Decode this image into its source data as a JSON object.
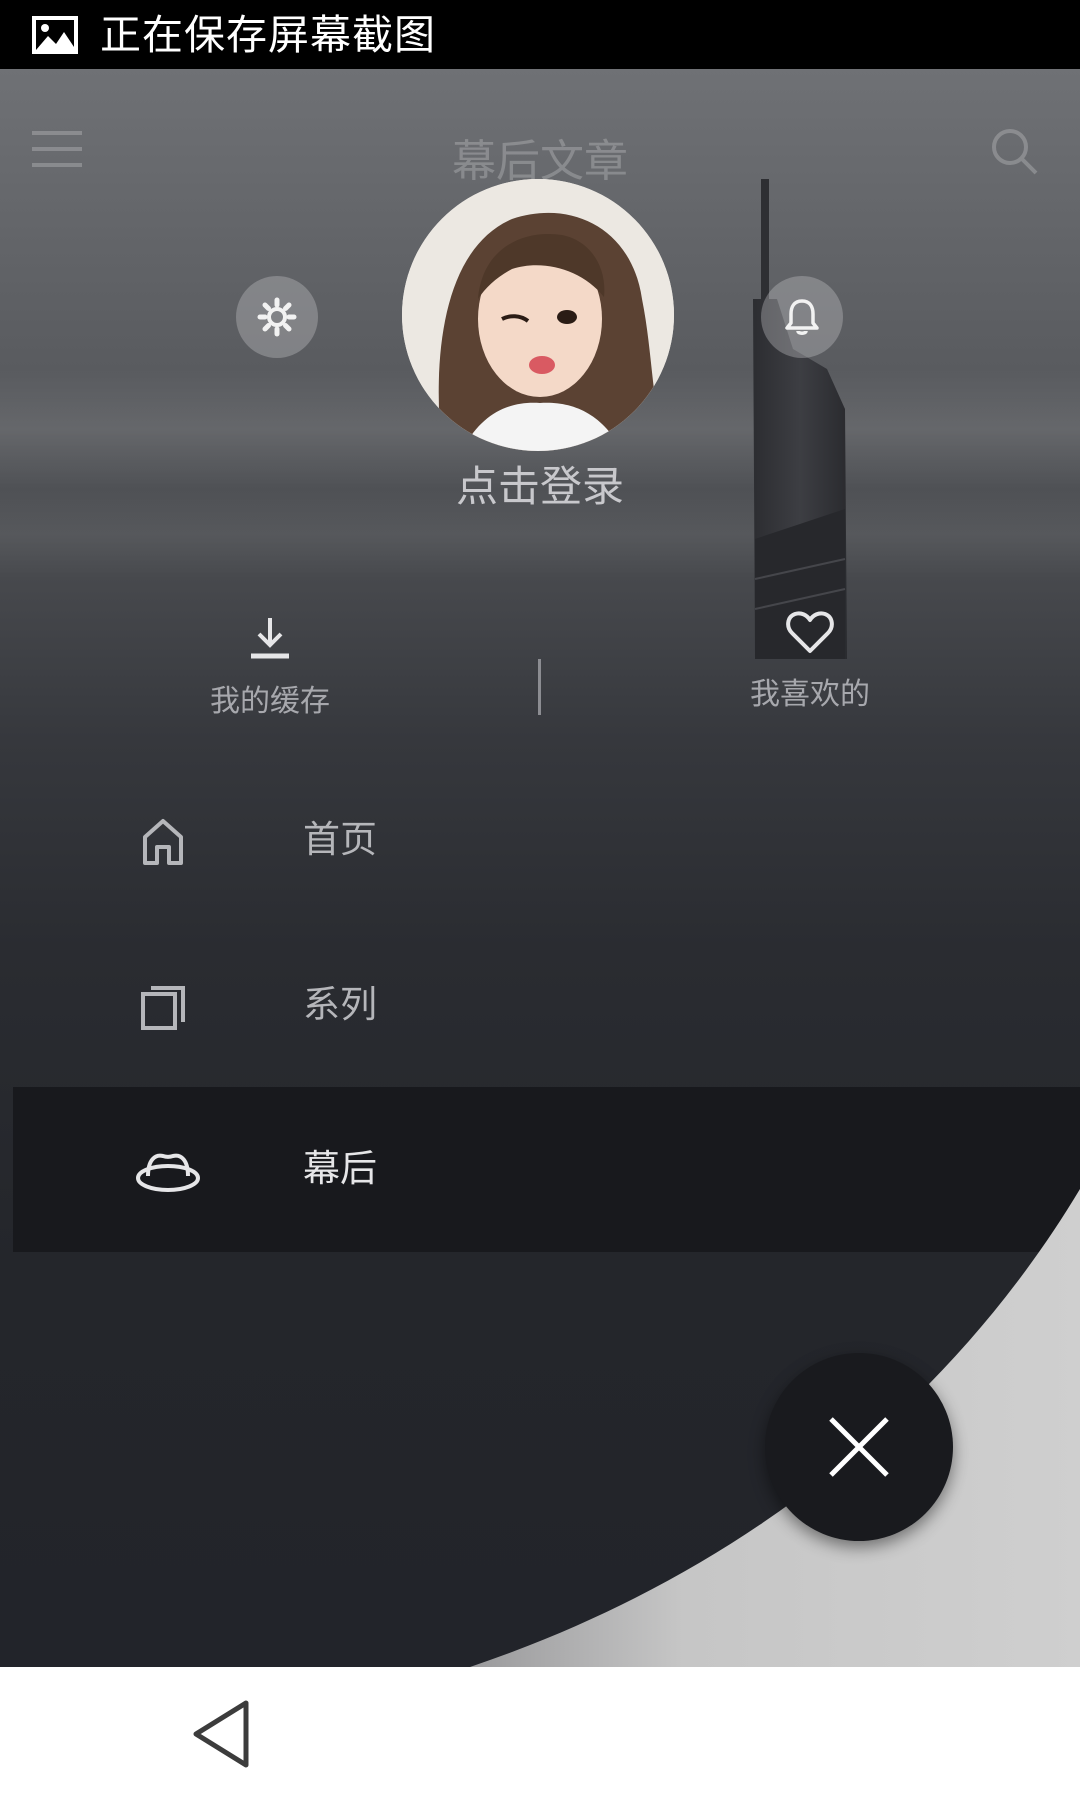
{
  "status_bar": {
    "notification_text": "正在保存屏幕截图",
    "icon": "image-icon"
  },
  "background_toolbar": {
    "title": "幕后文章",
    "menu_icon": "hamburger-menu-icon",
    "search_icon": "search-icon"
  },
  "drawer_header": {
    "settings_icon": "gear-icon",
    "notifications_icon": "bell-icon",
    "avatar": "user-avatar",
    "login_label": "点击登录"
  },
  "quick_actions": [
    {
      "label": "我的缓存",
      "icon": "download-icon"
    },
    {
      "label": "我喜欢的",
      "icon": "heart-icon"
    }
  ],
  "menu": {
    "items": [
      {
        "label": "首页",
        "icon": "home-icon",
        "active": false
      },
      {
        "label": "系列",
        "icon": "stacked-cards-icon",
        "active": false
      },
      {
        "label": "幕后",
        "icon": "hat-icon",
        "active": true
      }
    ]
  },
  "fab": {
    "icon": "close-icon"
  },
  "nav_bar": {
    "back_icon": "back-triangle-icon"
  },
  "colors": {
    "status_bar_bg": "#000000",
    "drawer_bg": "#24262b",
    "active_item_bg": "#18191d",
    "fab_bg": "#191a1e",
    "reveal_area": "#c6c6c6"
  }
}
